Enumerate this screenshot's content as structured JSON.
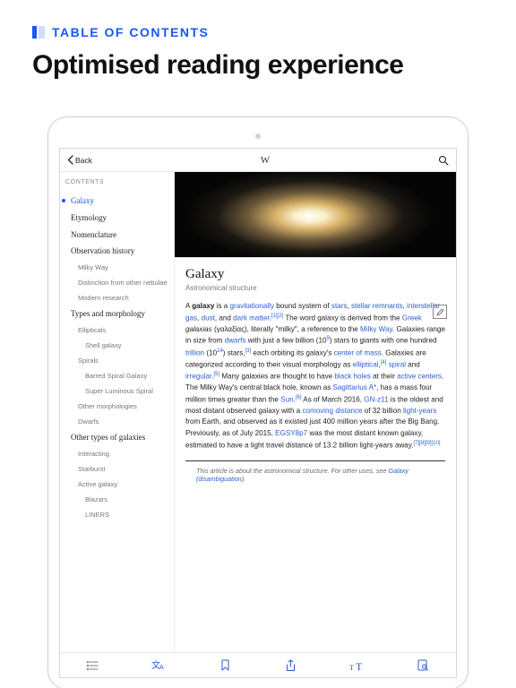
{
  "header": {
    "eyebrow": "TABLE OF CONTENTS",
    "headline": "Optimised reading experience"
  },
  "nav": {
    "back": "Back",
    "title": "W"
  },
  "toc": {
    "head": "CONTENTS",
    "items": [
      {
        "label": "Galaxy",
        "level": 1,
        "selected": true
      },
      {
        "label": "Etymology",
        "level": 1
      },
      {
        "label": "Nomenclature",
        "level": 1
      },
      {
        "label": "Observation history",
        "level": 1
      },
      {
        "label": "Milky Way",
        "level": 2
      },
      {
        "label": "Distinction from other nebulae",
        "level": 2
      },
      {
        "label": "Modern research",
        "level": 2
      },
      {
        "label": "Types and morphology",
        "level": 1
      },
      {
        "label": "Ellipticals",
        "level": 2
      },
      {
        "label": "Shell galaxy",
        "level": 3
      },
      {
        "label": "Spirals",
        "level": 2
      },
      {
        "label": "Barred Spiral Galaxy",
        "level": 3
      },
      {
        "label": "Super Luminous Spiral",
        "level": 3
      },
      {
        "label": "Other morphologies",
        "level": 2
      },
      {
        "label": "Dwarfs",
        "level": 2
      },
      {
        "label": "Other types of galaxies",
        "level": 1
      },
      {
        "label": "Interacting",
        "level": 2
      },
      {
        "label": "Starburst",
        "level": 2
      },
      {
        "label": "Active galaxy",
        "level": 2
      },
      {
        "label": "Blazars",
        "level": 3
      },
      {
        "label": "LINERS",
        "level": 3
      }
    ]
  },
  "article": {
    "title": "Galaxy",
    "subtitle": "Astronomical structure",
    "body_html": "A <b>galaxy</b> is a <a>gravitationally</a> bound system of <a>stars</a>, <a>stellar remnants</a>, <a>interstellar gas</a>, <a>dust</a>, and <a>dark matter</a>.<sup>[1][2]</sup> The word galaxy is derived from the <a>Greek</a> <i>galaxias</i> (γαλαξίας), literally \"milky\", a reference to the <a>Milky Way</a>. Galaxies range in size from <a>dwarfs</a> with just a few billion (10<sup>9</sup>) stars to giants with one hundred <a>trillion</a> (10<sup>14</sup>) stars,<sup>[3]</sup> each orbiting its galaxy's <a>center of mass</a>. Galaxies are categorized according to their visual morphology as <a>elliptical</a>,<sup>[4]</sup> <a>spiral</a> and <a>irregular</a>.<sup>[5]</sup> Many galaxies are thought to have <a>black holes</a> at their <a>active centers</a>. The Milky Way's central black hole, known as <a>Sagittarius A*</a>, has a mass four million times greater than the <a>Sun</a>.<sup>[6]</sup> As of March 2016, <a>GN-z11</a> is the oldest and most distant observed galaxy with a <a>comoving distance</a> of 32 billion <a>light-years</a> from Earth, and observed as it existed just 400 million years after the Big Bang. Previously, as of July 2015, <a>EGSY8p7</a> was the most distant known galaxy, estimated to have a light travel distance of 13.2 billion light-years away.<sup>[7][8][9][10]</sup>",
    "hatnote_html": "This article is about the astronomical structure. For other uses, see <a>Galaxy (disambiguation)</a>."
  },
  "toolbar": {
    "items": [
      "toc-icon",
      "language-icon",
      "bookmark-icon",
      "share-icon",
      "font-icon",
      "find-icon"
    ]
  }
}
